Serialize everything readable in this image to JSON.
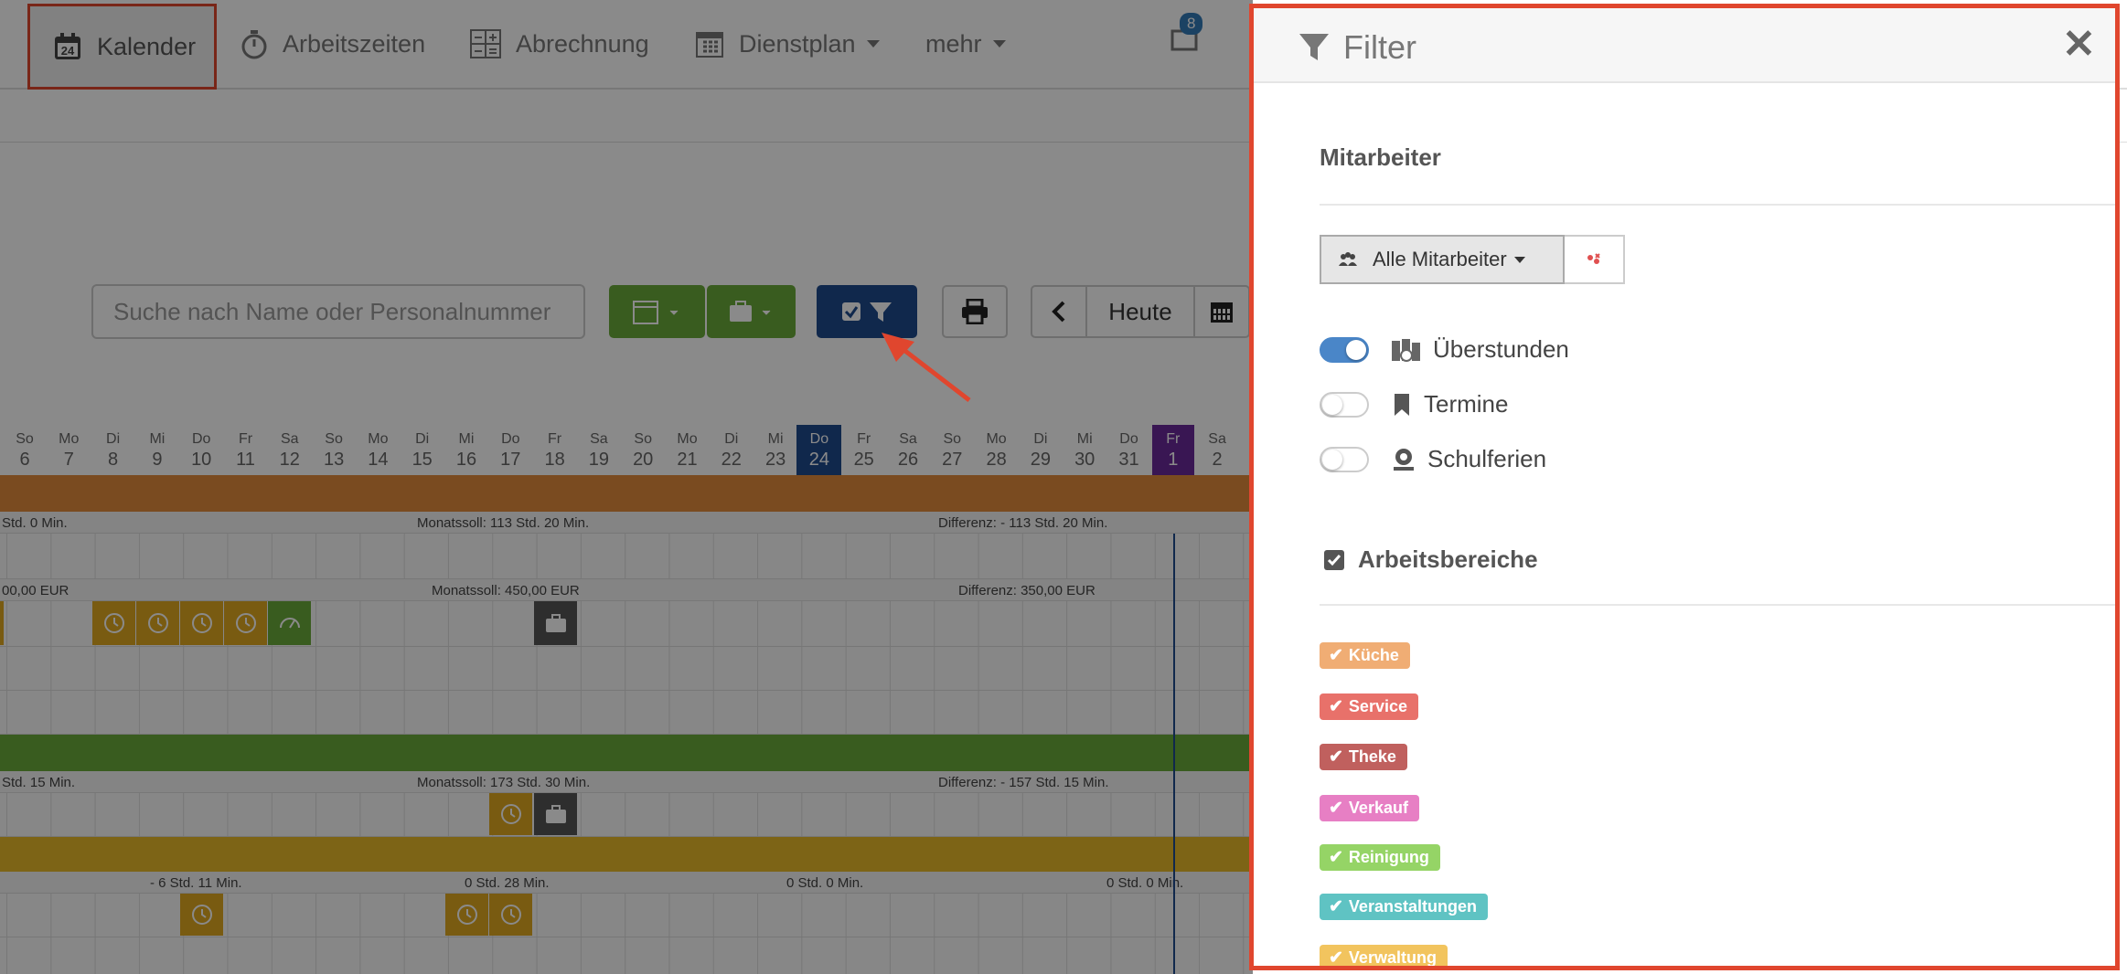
{
  "nav": {
    "items": [
      {
        "label": "Kalender",
        "icon": "calendar-24-icon"
      },
      {
        "label": "Arbeitszeiten",
        "icon": "stopwatch-icon"
      },
      {
        "label": "Abrechnung",
        "icon": "calculator-icon"
      },
      {
        "label": "Dienstplan",
        "icon": "calendar-grid-icon"
      },
      {
        "label": "mehr"
      }
    ],
    "calendar_number": "24",
    "message_count": "8"
  },
  "toolbar": {
    "search_placeholder": "Suche nach Name oder Personalnummer",
    "today_label": "Heute"
  },
  "calendar": {
    "days": [
      {
        "wd": "So",
        "n": "6"
      },
      {
        "wd": "Mo",
        "n": "7"
      },
      {
        "wd": "Di",
        "n": "8"
      },
      {
        "wd": "Mi",
        "n": "9"
      },
      {
        "wd": "Do",
        "n": "10"
      },
      {
        "wd": "Fr",
        "n": "11"
      },
      {
        "wd": "Sa",
        "n": "12"
      },
      {
        "wd": "So",
        "n": "13"
      },
      {
        "wd": "Mo",
        "n": "14"
      },
      {
        "wd": "Di",
        "n": "15"
      },
      {
        "wd": "Mi",
        "n": "16"
      },
      {
        "wd": "Do",
        "n": "17"
      },
      {
        "wd": "Fr",
        "n": "18"
      },
      {
        "wd": "Sa",
        "n": "19"
      },
      {
        "wd": "So",
        "n": "20"
      },
      {
        "wd": "Mo",
        "n": "21"
      },
      {
        "wd": "Di",
        "n": "22"
      },
      {
        "wd": "Mi",
        "n": "23"
      },
      {
        "wd": "Do",
        "n": "24"
      },
      {
        "wd": "Fr",
        "n": "25"
      },
      {
        "wd": "Sa",
        "n": "26"
      },
      {
        "wd": "So",
        "n": "27"
      },
      {
        "wd": "Mo",
        "n": "28"
      },
      {
        "wd": "Di",
        "n": "29"
      },
      {
        "wd": "Mi",
        "n": "30"
      },
      {
        "wd": "Do",
        "n": "31"
      },
      {
        "wd": "Fr",
        "n": "1"
      },
      {
        "wd": "Sa",
        "n": "2"
      }
    ],
    "summary_1": {
      "a": "Std. 0 Min.",
      "b": "Monatssoll: 113 Std. 20 Min.",
      "c": "Differenz: - 113 Std. 20 Min."
    },
    "summary_2": {
      "a": "00,00 EUR",
      "b": "Monatssoll: 450,00 EUR",
      "c": "Differenz: 350,00 EUR"
    },
    "summary_3": {
      "a": "Std. 15 Min.",
      "b": "Monatssoll: 173 Std. 30 Min.",
      "c": "Differenz: - 157 Std. 15 Min."
    },
    "summary_4": {
      "a": "- 6 Std. 11 Min.",
      "b": "0 Std. 28 Min.",
      "c": "0 Std. 0 Min.",
      "d": "0 Std. 0 Min."
    }
  },
  "filter": {
    "title": "Filter",
    "close": "✕",
    "section_employees": "Mitarbeiter",
    "employee_select": "Alle Mitarbeiter",
    "toggles": [
      {
        "label": "Überstunden",
        "on": true,
        "icon": "overtime-icon"
      },
      {
        "label": "Termine",
        "on": false,
        "icon": "bookmark-icon"
      },
      {
        "label": "Schulferien",
        "on": false,
        "icon": "school-icon"
      }
    ],
    "section_areas": "Arbeitsbereiche",
    "areas": [
      {
        "label": "Küche",
        "color": "#f0ad74"
      },
      {
        "label": "Service",
        "color": "#e8716a"
      },
      {
        "label": "Theke",
        "color": "#c0605e"
      },
      {
        "label": "Verkauf",
        "color": "#e77fc4"
      },
      {
        "label": "Reinigung",
        "color": "#95d466"
      },
      {
        "label": "Veranstaltungen",
        "color": "#5fc3c3"
      },
      {
        "label": "Verwaltung",
        "color": "#f2c45e"
      }
    ]
  },
  "colors": {
    "accent": "#1f4a8d",
    "highlight": "#e0462e",
    "green": "#6aaa3a"
  }
}
